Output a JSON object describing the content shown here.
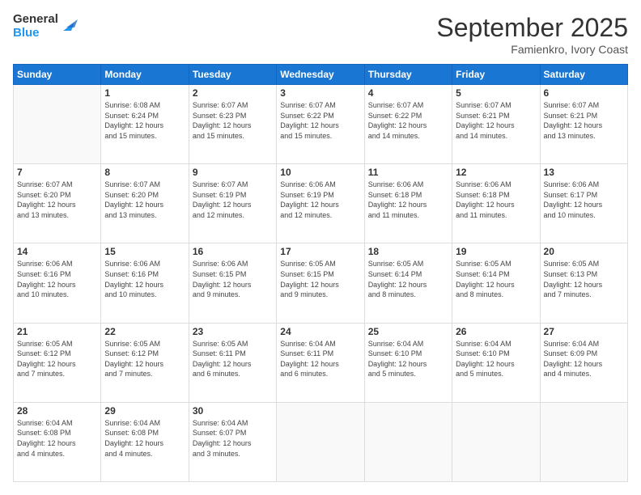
{
  "logo": {
    "line1": "General",
    "line2": "Blue"
  },
  "header": {
    "month_year": "September 2025",
    "location": "Famienkro, Ivory Coast"
  },
  "weekdays": [
    "Sunday",
    "Monday",
    "Tuesday",
    "Wednesday",
    "Thursday",
    "Friday",
    "Saturday"
  ],
  "weeks": [
    [
      {
        "day": "",
        "info": ""
      },
      {
        "day": "1",
        "info": "Sunrise: 6:08 AM\nSunset: 6:24 PM\nDaylight: 12 hours\nand 15 minutes."
      },
      {
        "day": "2",
        "info": "Sunrise: 6:07 AM\nSunset: 6:23 PM\nDaylight: 12 hours\nand 15 minutes."
      },
      {
        "day": "3",
        "info": "Sunrise: 6:07 AM\nSunset: 6:22 PM\nDaylight: 12 hours\nand 15 minutes."
      },
      {
        "day": "4",
        "info": "Sunrise: 6:07 AM\nSunset: 6:22 PM\nDaylight: 12 hours\nand 14 minutes."
      },
      {
        "day": "5",
        "info": "Sunrise: 6:07 AM\nSunset: 6:21 PM\nDaylight: 12 hours\nand 14 minutes."
      },
      {
        "day": "6",
        "info": "Sunrise: 6:07 AM\nSunset: 6:21 PM\nDaylight: 12 hours\nand 13 minutes."
      }
    ],
    [
      {
        "day": "7",
        "info": "Sunrise: 6:07 AM\nSunset: 6:20 PM\nDaylight: 12 hours\nand 13 minutes."
      },
      {
        "day": "8",
        "info": "Sunrise: 6:07 AM\nSunset: 6:20 PM\nDaylight: 12 hours\nand 13 minutes."
      },
      {
        "day": "9",
        "info": "Sunrise: 6:07 AM\nSunset: 6:19 PM\nDaylight: 12 hours\nand 12 minutes."
      },
      {
        "day": "10",
        "info": "Sunrise: 6:06 AM\nSunset: 6:19 PM\nDaylight: 12 hours\nand 12 minutes."
      },
      {
        "day": "11",
        "info": "Sunrise: 6:06 AM\nSunset: 6:18 PM\nDaylight: 12 hours\nand 11 minutes."
      },
      {
        "day": "12",
        "info": "Sunrise: 6:06 AM\nSunset: 6:18 PM\nDaylight: 12 hours\nand 11 minutes."
      },
      {
        "day": "13",
        "info": "Sunrise: 6:06 AM\nSunset: 6:17 PM\nDaylight: 12 hours\nand 10 minutes."
      }
    ],
    [
      {
        "day": "14",
        "info": "Sunrise: 6:06 AM\nSunset: 6:16 PM\nDaylight: 12 hours\nand 10 minutes."
      },
      {
        "day": "15",
        "info": "Sunrise: 6:06 AM\nSunset: 6:16 PM\nDaylight: 12 hours\nand 10 minutes."
      },
      {
        "day": "16",
        "info": "Sunrise: 6:06 AM\nSunset: 6:15 PM\nDaylight: 12 hours\nand 9 minutes."
      },
      {
        "day": "17",
        "info": "Sunrise: 6:05 AM\nSunset: 6:15 PM\nDaylight: 12 hours\nand 9 minutes."
      },
      {
        "day": "18",
        "info": "Sunrise: 6:05 AM\nSunset: 6:14 PM\nDaylight: 12 hours\nand 8 minutes."
      },
      {
        "day": "19",
        "info": "Sunrise: 6:05 AM\nSunset: 6:14 PM\nDaylight: 12 hours\nand 8 minutes."
      },
      {
        "day": "20",
        "info": "Sunrise: 6:05 AM\nSunset: 6:13 PM\nDaylight: 12 hours\nand 7 minutes."
      }
    ],
    [
      {
        "day": "21",
        "info": "Sunrise: 6:05 AM\nSunset: 6:12 PM\nDaylight: 12 hours\nand 7 minutes."
      },
      {
        "day": "22",
        "info": "Sunrise: 6:05 AM\nSunset: 6:12 PM\nDaylight: 12 hours\nand 7 minutes."
      },
      {
        "day": "23",
        "info": "Sunrise: 6:05 AM\nSunset: 6:11 PM\nDaylight: 12 hours\nand 6 minutes."
      },
      {
        "day": "24",
        "info": "Sunrise: 6:04 AM\nSunset: 6:11 PM\nDaylight: 12 hours\nand 6 minutes."
      },
      {
        "day": "25",
        "info": "Sunrise: 6:04 AM\nSunset: 6:10 PM\nDaylight: 12 hours\nand 5 minutes."
      },
      {
        "day": "26",
        "info": "Sunrise: 6:04 AM\nSunset: 6:10 PM\nDaylight: 12 hours\nand 5 minutes."
      },
      {
        "day": "27",
        "info": "Sunrise: 6:04 AM\nSunset: 6:09 PM\nDaylight: 12 hours\nand 4 minutes."
      }
    ],
    [
      {
        "day": "28",
        "info": "Sunrise: 6:04 AM\nSunset: 6:08 PM\nDaylight: 12 hours\nand 4 minutes."
      },
      {
        "day": "29",
        "info": "Sunrise: 6:04 AM\nSunset: 6:08 PM\nDaylight: 12 hours\nand 4 minutes."
      },
      {
        "day": "30",
        "info": "Sunrise: 6:04 AM\nSunset: 6:07 PM\nDaylight: 12 hours\nand 3 minutes."
      },
      {
        "day": "",
        "info": ""
      },
      {
        "day": "",
        "info": ""
      },
      {
        "day": "",
        "info": ""
      },
      {
        "day": "",
        "info": ""
      }
    ]
  ]
}
